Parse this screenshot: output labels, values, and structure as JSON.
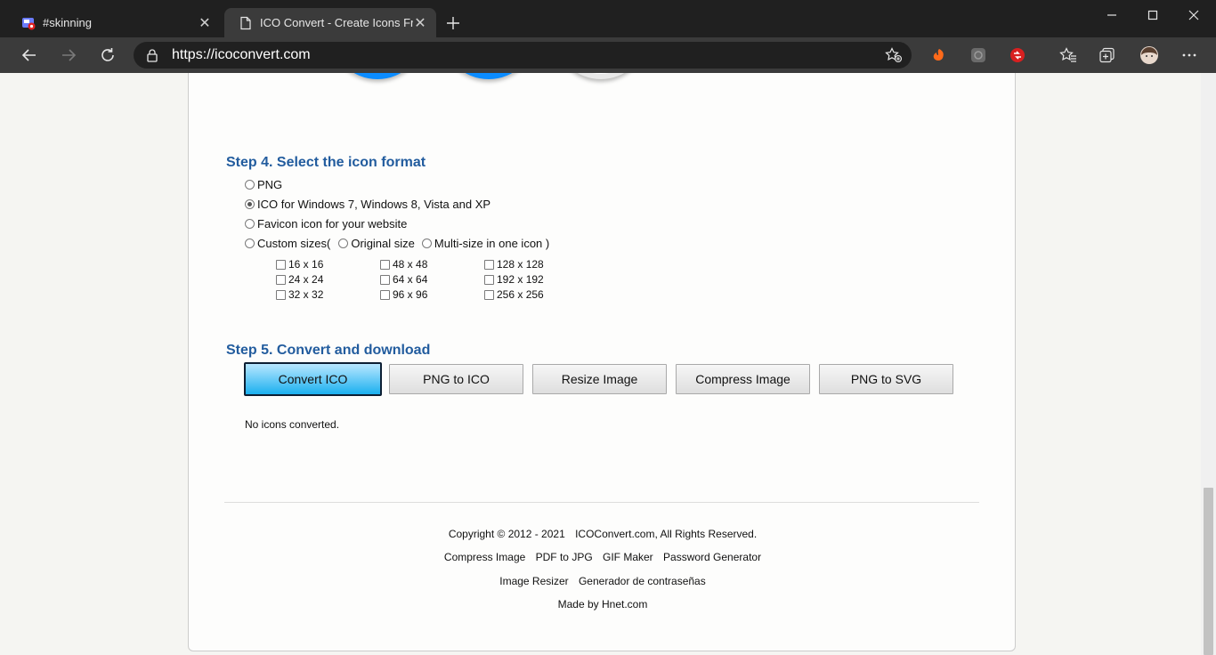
{
  "tabs": [
    {
      "title": "#skinning",
      "active": false
    },
    {
      "title": "ICO Convert - Create Icons From",
      "active": true
    }
  ],
  "address": {
    "url": "https://icoconvert.com"
  },
  "step4": {
    "title": "Step 4. Select the icon format",
    "options": {
      "png": "PNG",
      "ico": "ICO for Windows 7, Windows 8, Vista and XP",
      "favicon": "Favicon icon for your website",
      "custom": "Custom sizes(",
      "original": "Original size",
      "multi": "Multi-size in one icon )"
    },
    "sizes": [
      "16 x 16",
      "24 x 24",
      "32 x 32",
      "48 x 48",
      "64 x 64",
      "96 x 96",
      "128 x 128",
      "192 x 192",
      "256 x 256"
    ]
  },
  "step5": {
    "title": "Step 5. Convert and download",
    "buttons": {
      "convert": "Convert ICO",
      "png_to_ico": "PNG to ICO",
      "resize": "Resize Image",
      "compress": "Compress Image",
      "png_to_svg": "PNG to SVG"
    },
    "status": "No icons converted."
  },
  "footer": {
    "copyright": "Copyright © 2012 - 2021",
    "rights": "ICOConvert.com, All Rights Reserved.",
    "links1": [
      "Compress Image",
      "PDF to JPG",
      "GIF Maker",
      "Password Generator"
    ],
    "links2": [
      "Image Resizer",
      "Generador de contraseñas"
    ],
    "made_by": "Made by Hnet.com"
  },
  "colors": {
    "heading": "#225c9e",
    "accent_button": "#1bb0ef",
    "page_bg": "#f5f5f2"
  }
}
